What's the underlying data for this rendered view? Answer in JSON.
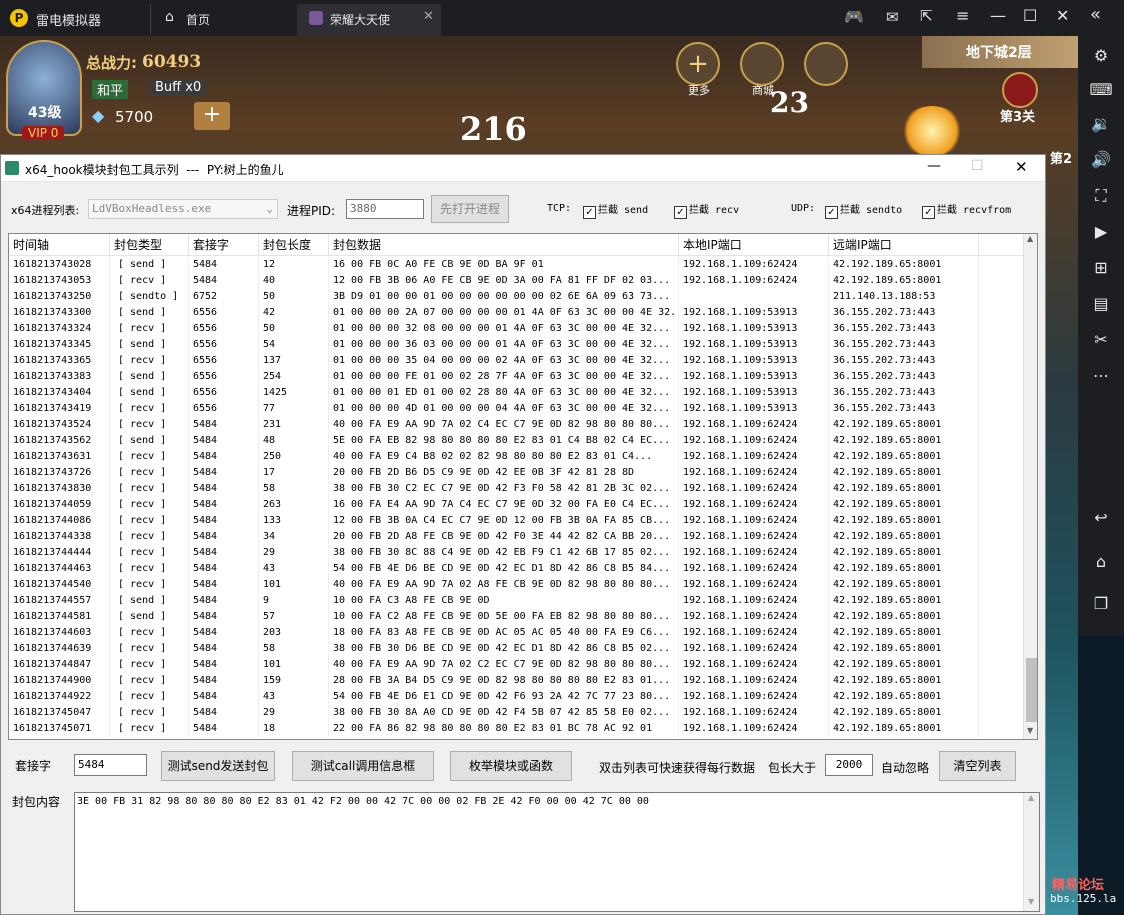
{
  "emulator": {
    "app_title": "雷电模拟器",
    "tab_home": "首页",
    "tab_game": "荣耀大天使"
  },
  "game": {
    "power_label": "总战力:",
    "power_value": "60493",
    "mode": "和平",
    "buff": "Buff x0",
    "level": "43级",
    "vip": "VIP 0",
    "diamonds": "5700",
    "more": "更多",
    "shop": "商城",
    "dungeon": "地下城2层",
    "stage": "第3关",
    "damage1": "216",
    "damage2": "23",
    "side_text": "第2"
  },
  "tool": {
    "title": "x64_hook模块封包工具示列  ---  PY:树上的鱼儿",
    "proc_label": "x64进程列表:",
    "proc_value": "LdVBoxHeadless.exe",
    "pid_label": "进程PID:",
    "pid_value": "3880",
    "open_btn": "先打开进程",
    "tcp_label": "TCP:",
    "tcp_send": "拦截 send",
    "tcp_recv": "拦截 recv",
    "udp_label": "UDP:",
    "udp_sendto": "拦截 sendto",
    "udp_recvfrom": "拦截 recvfrom",
    "columns": [
      "时间轴",
      "封包类型",
      "套接字",
      "封包长度",
      "封包数据",
      "本地IP端口",
      "远端IP端口"
    ],
    "rows": [
      [
        "1618213743028",
        "[ send ]",
        "5484",
        "12",
        "16 00 FB 0C A0 FE CB 9E 0D BA 9F 01",
        "192.168.1.109:62424",
        "42.192.189.65:8001"
      ],
      [
        "1618213743053",
        "[ recv ]",
        "5484",
        "40",
        "12 00 FB 3B 06 A0 FE CB 9E 0D 3A 00 FA 81 FF DF 02 03...",
        "192.168.1.109:62424",
        "42.192.189.65:8001"
      ],
      [
        "1618213743250",
        "[ sendto ]",
        "6752",
        "50",
        "3B D9 01 00 00 01 00 00 00 00 00 00 02 6E 6A 09 63 73...",
        "",
        "211.140.13.188:53"
      ],
      [
        "1618213743300",
        "[ send ]",
        "6556",
        "42",
        "01 00 00 00 2A 07 00 00 00 00 01 4A 0F 63 3C 00 00 4E 32...",
        "192.168.1.109:53913",
        "36.155.202.73:443"
      ],
      [
        "1618213743324",
        "[ recv ]",
        "6556",
        "50",
        "01 00 00 00 32 08 00 00 00 01 4A 0F 63 3C 00 00 4E 32...",
        "192.168.1.109:53913",
        "36.155.202.73:443"
      ],
      [
        "1618213743345",
        "[ send ]",
        "6556",
        "54",
        "01 00 00 00 36 03 00 00 00 01 4A 0F 63 3C 00 00 4E 32...",
        "192.168.1.109:53913",
        "36.155.202.73:443"
      ],
      [
        "1618213743365",
        "[ recv ]",
        "6556",
        "137",
        "01 00 00 00 35 04 00 00 00 02 4A 0F 63 3C 00 00 4E 32...",
        "192.168.1.109:53913",
        "36.155.202.73:443"
      ],
      [
        "1618213743383",
        "[ send ]",
        "6556",
        "254",
        "01 00 00 00 FE 01 00 02 28 7F 4A 0F 63 3C 00 00 4E 32...",
        "192.168.1.109:53913",
        "36.155.202.73:443"
      ],
      [
        "1618213743404",
        "[ send ]",
        "6556",
        "1425",
        "01 00 00 01 ED 01 00 02 28 80 4A 0F 63 3C 00 00 4E 32...",
        "192.168.1.109:53913",
        "36.155.202.73:443"
      ],
      [
        "1618213743419",
        "[ recv ]",
        "6556",
        "77",
        "01 00 00 00 4D 01 00 00 00 04 4A 0F 63 3C 00 00 4E 32...",
        "192.168.1.109:53913",
        "36.155.202.73:443"
      ],
      [
        "1618213743524",
        "[ recv ]",
        "5484",
        "231",
        "40 00 FA E9 AA 9D 7A 02 C4 EC C7 9E 0D 82 98 80 80 80...",
        "192.168.1.109:62424",
        "42.192.189.65:8001"
      ],
      [
        "1618213743562",
        "[ send ]",
        "5484",
        "48",
        "5E 00 FA EB 82 98 80 80 80 80 E2 83 01 C4 B8 02 C4 EC...",
        "192.168.1.109:62424",
        "42.192.189.65:8001"
      ],
      [
        "1618213743631",
        "[ recv ]",
        "5484",
        "250",
        "40 00 FA E9 C4 B8 02 02 82 98 80 80 80 E2 83 01 C4...",
        "192.168.1.109:62424",
        "42.192.189.65:8001"
      ],
      [
        "1618213743726",
        "[ recv ]",
        "5484",
        "17",
        "20 00 FB 2D B6 D5 C9 9E 0D 42 EE 0B 3F 42 81 28 8D",
        "192.168.1.109:62424",
        "42.192.189.65:8001"
      ],
      [
        "1618213743830",
        "[ recv ]",
        "5484",
        "58",
        "38 00 FB 30 C2 EC C7 9E 0D 42 F3 F0 58 42 81 2B 3C 02...",
        "192.168.1.109:62424",
        "42.192.189.65:8001"
      ],
      [
        "1618213744059",
        "[ recv ]",
        "5484",
        "263",
        "16 00 FA E4 AA 9D 7A C4 EC C7 9E 0D 32 00 FA E0 C4 EC...",
        "192.168.1.109:62424",
        "42.192.189.65:8001"
      ],
      [
        "1618213744086",
        "[ recv ]",
        "5484",
        "133",
        "12 00 FB 3B 0A C4 EC C7 9E 0D 12 00 FB 3B 0A FA 85 CB...",
        "192.168.1.109:62424",
        "42.192.189.65:8001"
      ],
      [
        "1618213744338",
        "[ recv ]",
        "5484",
        "34",
        "20 00 FB 2D A8 FE CB 9E 0D 42 F0 3E 44 42 82 CA BB 20...",
        "192.168.1.109:62424",
        "42.192.189.65:8001"
      ],
      [
        "1618213744444",
        "[ recv ]",
        "5484",
        "29",
        "38 00 FB 30 8C 88 C4 9E 0D 42 EB F9 C1 42 6B 17 85 02...",
        "192.168.1.109:62424",
        "42.192.189.65:8001"
      ],
      [
        "1618213744463",
        "[ recv ]",
        "5484",
        "43",
        "54 00 FB 4E D6 BE CD 9E 0D 42 EC D1 8D 42 86 C8 B5 84...",
        "192.168.1.109:62424",
        "42.192.189.65:8001"
      ],
      [
        "1618213744540",
        "[ recv ]",
        "5484",
        "101",
        "40 00 FA E9 AA 9D 7A 02 A8 FE CB 9E 0D 82 98 80 80 80...",
        "192.168.1.109:62424",
        "42.192.189.65:8001"
      ],
      [
        "1618213744557",
        "[ send ]",
        "5484",
        "9",
        "10 00 FA C3 A8 FE CB 9E 0D",
        "192.168.1.109:62424",
        "42.192.189.65:8001"
      ],
      [
        "1618213744581",
        "[ send ]",
        "5484",
        "57",
        "10 00 FA C2 A8 FE CB 9E 0D 5E 00 FA EB 82 98 80 80 80...",
        "192.168.1.109:62424",
        "42.192.189.65:8001"
      ],
      [
        "1618213744603",
        "[ recv ]",
        "5484",
        "203",
        "18 00 FA 83 A8 FE CB 9E 0D AC 05 AC 05 40 00 FA E9 C6...",
        "192.168.1.109:62424",
        "42.192.189.65:8001"
      ],
      [
        "1618213744639",
        "[ recv ]",
        "5484",
        "58",
        "38 00 FB 30 D6 BE CD 9E 0D 42 EC D1 8D 42 86 C8 B5 02...",
        "192.168.1.109:62424",
        "42.192.189.65:8001"
      ],
      [
        "1618213744847",
        "[ recv ]",
        "5484",
        "101",
        "40 00 FA E9 AA 9D 7A 02 C2 EC C7 9E 0D 82 98 80 80 80...",
        "192.168.1.109:62424",
        "42.192.189.65:8001"
      ],
      [
        "1618213744900",
        "[ recv ]",
        "5484",
        "159",
        "28 00 FB 3A B4 D5 C9 9E 0D 82 98 80 80 80 80 E2 83 01...",
        "192.168.1.109:62424",
        "42.192.189.65:8001"
      ],
      [
        "1618213744922",
        "[ recv ]",
        "5484",
        "43",
        "54 00 FB 4E D6 E1 CD 9E 0D 42 F6 93 2A 42 7C 77 23 80...",
        "192.168.1.109:62424",
        "42.192.189.65:8001"
      ],
      [
        "1618213745047",
        "[ recv ]",
        "5484",
        "29",
        "38 00 FB 30 8A A0 CD 9E 0D 42 F4 5B 07 42 85 58 E0 02...",
        "192.168.1.109:62424",
        "42.192.189.65:8001"
      ],
      [
        "1618213745071",
        "[ recv ]",
        "5484",
        "18",
        "22 00 FA 86 82 98 80 80 80 80 E2 83 01 BC 78 AC 92 01",
        "192.168.1.109:62424",
        "42.192.189.65:8001"
      ]
    ],
    "socket_label": "套接字",
    "socket_value": "5484",
    "btn_send": "测试send发送封包",
    "btn_call": "测试call调用信息框",
    "btn_enum": "枚举模块或函数",
    "hint": "双击列表可快速获得每行数据",
    "len_label": "包长大于",
    "len_value": "2000",
    "auto_ignore": "自动忽略",
    "btn_clear": "清空列表",
    "content_label": "封包内容",
    "content_value": "3E 00 FB 31 82 98 80 80 80 80 E2 83 01 42 F2 00 00 42 7C 00 00 02 FB 2E 42 F0 00 00 42 7C 00 00"
  },
  "watermark": {
    "line1": "精易论坛",
    "line2": "bbs.125.la"
  }
}
